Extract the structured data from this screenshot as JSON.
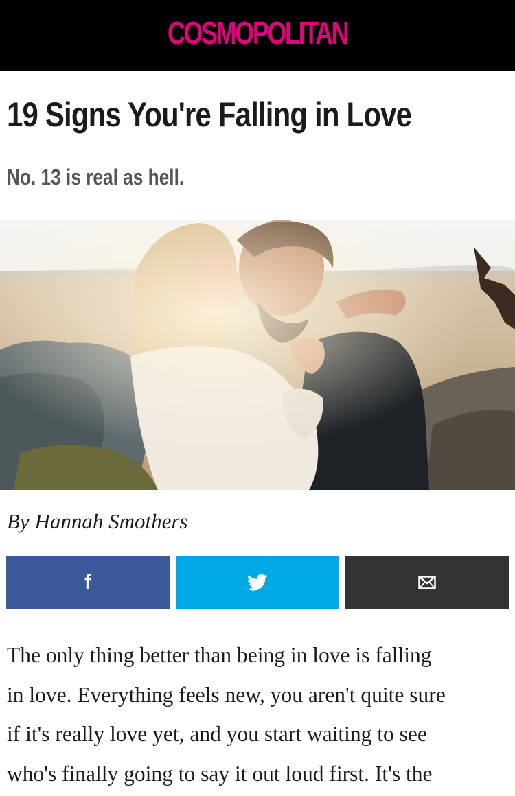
{
  "header": {
    "logo_text": "COSMOPOLITAN",
    "logo_color": "#e5007d",
    "background": "#000000"
  },
  "article": {
    "title": "19 Signs You're Falling in Love",
    "dek": "No. 13 is real as hell.",
    "hero_image": "couple-embracing-photo",
    "byline": "By Hannah Smothers",
    "body_lines": [
      "The only thing better than being in love is falling",
      "in love. Everything feels new, you aren't quite sure",
      "if it's really love yet, and you start waiting to see",
      "who's finally going to say it out loud first. It's the"
    ]
  },
  "share": {
    "facebook": {
      "icon": "facebook-icon",
      "color": "#3b5998"
    },
    "twitter": {
      "icon": "twitter-bird-icon",
      "color": "#00a8e6"
    },
    "email": {
      "icon": "envelope-icon",
      "color": "#333333"
    }
  }
}
